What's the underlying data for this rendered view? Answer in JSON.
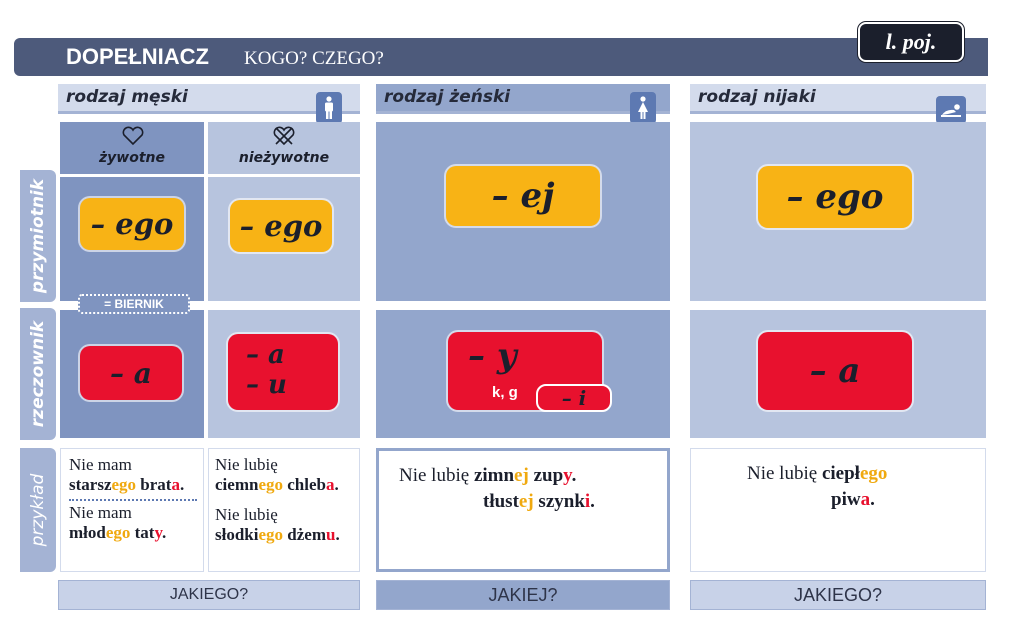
{
  "header": {
    "title": "DOPEŁNIACZ",
    "subtitle": "KOGO? CZEGO?",
    "number_badge": "l. poj."
  },
  "columns": {
    "masc": {
      "label": "rodzaj męski",
      "icon": "man-icon"
    },
    "fem": {
      "label": "rodzaj żeński",
      "icon": "woman-icon"
    },
    "neut": {
      "label": "rodzaj nijaki",
      "icon": "baby-icon"
    }
  },
  "subcolumns": {
    "animate": "żywotne",
    "inanimate": "nieżywotne"
  },
  "rows": {
    "adjective": "przymiotnik",
    "noun": "rzeczownik",
    "example": "przykład"
  },
  "biernik_note": "= BIERNIK",
  "endings": {
    "adj_masc_anim": "– ego",
    "adj_masc_inan": "– ego",
    "adj_fem": "– ej",
    "adj_neut": "– ego",
    "noun_masc_anim": "– a",
    "noun_masc_inan_1": "– a",
    "noun_masc_inan_2": "– u",
    "noun_fem": "– y",
    "noun_fem_note": "k, g",
    "noun_fem_alt": "– i",
    "noun_neut": "– a"
  },
  "examples": {
    "masc_anim": {
      "e1_lead": "Nie mam",
      "e1": [
        "starsz",
        "ego",
        " brat",
        "a",
        "."
      ],
      "e2_lead": "Nie mam",
      "e2": [
        "młod",
        "ego",
        " tat",
        "y",
        "."
      ]
    },
    "masc_inan": {
      "e1_lead": "Nie lubię",
      "e1": [
        "ciemn",
        "ego",
        " chleb",
        "a",
        "."
      ],
      "e2_lead": "Nie lubię",
      "e2": [
        "słodki",
        "ego",
        " dżem",
        "u",
        "."
      ]
    },
    "fem": {
      "lead": "Nie lubię",
      "l1": [
        "zimn",
        "ej",
        " zup",
        "y",
        "."
      ],
      "l2": [
        "tłust",
        "ej",
        " szynk",
        "i",
        "."
      ]
    },
    "neut": {
      "lead": "Nie lubię",
      "l1": [
        "ciepł",
        "ego"
      ],
      "l2": [
        "piw",
        "a",
        "."
      ]
    }
  },
  "questions": {
    "masc": "JAKIEGO?",
    "fem": "JAKIEJ?",
    "neut": "JAKIEGO?"
  },
  "colors": {
    "yellow": "#f8b315",
    "red": "#e8112e",
    "header": "#4d5a7b",
    "cell": "#93a6cc"
  }
}
